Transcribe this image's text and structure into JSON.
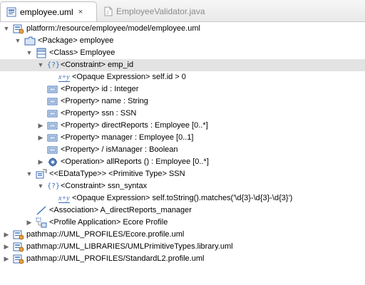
{
  "tabs": [
    {
      "label": "employee.uml",
      "close": "×",
      "active": true,
      "icon": "uml-file-icon"
    },
    {
      "label": "EmployeeValidator.java",
      "active": false,
      "icon": "java-file-icon"
    }
  ],
  "tree": [
    {
      "text": "platform:/resource/employee/model/employee.uml",
      "depth": 0,
      "expander": "expanded",
      "icon": "resource-icon"
    },
    {
      "text": "<Package> employee",
      "depth": 1,
      "expander": "expanded",
      "icon": "package-icon"
    },
    {
      "text": "<Class> Employee",
      "depth": 2,
      "expander": "expanded",
      "icon": "class-icon"
    },
    {
      "text": "<Constraint> emp_id",
      "depth": 3,
      "expander": "expanded",
      "icon": "constraint-icon",
      "selected": true
    },
    {
      "text": "<Opaque Expression> self.id > 0",
      "depth": 4,
      "expander": "none",
      "icon": "opaque-expression-icon"
    },
    {
      "text": "<Property> id : Integer",
      "depth": 3,
      "expander": "none",
      "icon": "property-icon"
    },
    {
      "text": "<Property> name : String",
      "depth": 3,
      "expander": "none",
      "icon": "property-icon"
    },
    {
      "text": "<Property> ssn : SSN",
      "depth": 3,
      "expander": "none",
      "icon": "property-icon"
    },
    {
      "text": "<Property> directReports : Employee [0..*]",
      "depth": 3,
      "expander": "collapsed",
      "icon": "property-icon"
    },
    {
      "text": "<Property> manager : Employee [0..1]",
      "depth": 3,
      "expander": "collapsed",
      "icon": "property-icon"
    },
    {
      "text": "<Property> / isManager : Boolean",
      "depth": 3,
      "expander": "none",
      "icon": "property-icon"
    },
    {
      "text": "<Operation> allReports () : Employee [0..*]",
      "depth": 3,
      "expander": "collapsed",
      "icon": "operation-icon"
    },
    {
      "text": "<<EDataType>> <Primitive Type> SSN",
      "depth": 2,
      "expander": "expanded",
      "icon": "primitive-type-icon"
    },
    {
      "text": "<Constraint> ssn_syntax",
      "depth": 3,
      "expander": "expanded",
      "icon": "constraint-icon"
    },
    {
      "text": "<Opaque Expression> self.toString().matches('\\d{3}-\\d{3}-\\d{3}')",
      "depth": 4,
      "expander": "none",
      "icon": "opaque-expression-icon"
    },
    {
      "text": "<Association> A_directReports_manager",
      "depth": 2,
      "expander": "none",
      "icon": "association-icon"
    },
    {
      "text": "<Profile Application> Ecore Profile",
      "depth": 2,
      "expander": "collapsed",
      "icon": "profile-application-icon"
    },
    {
      "text": "pathmap://UML_PROFILES/Ecore.profile.uml",
      "depth": 0,
      "expander": "collapsed",
      "icon": "resource-icon"
    },
    {
      "text": "pathmap://UML_LIBRARIES/UMLPrimitiveTypes.library.uml",
      "depth": 0,
      "expander": "collapsed",
      "icon": "resource-icon"
    },
    {
      "text": "pathmap://UML_PROFILES/StandardL2.profile.uml",
      "depth": 0,
      "expander": "collapsed",
      "icon": "resource-icon"
    }
  ],
  "icon_glyphs": {
    "constraint": "{?}",
    "opaque_expression": "x+y"
  },
  "colors": {
    "selection": "#e3e3e3",
    "icon_blue": "#3a6db5"
  }
}
